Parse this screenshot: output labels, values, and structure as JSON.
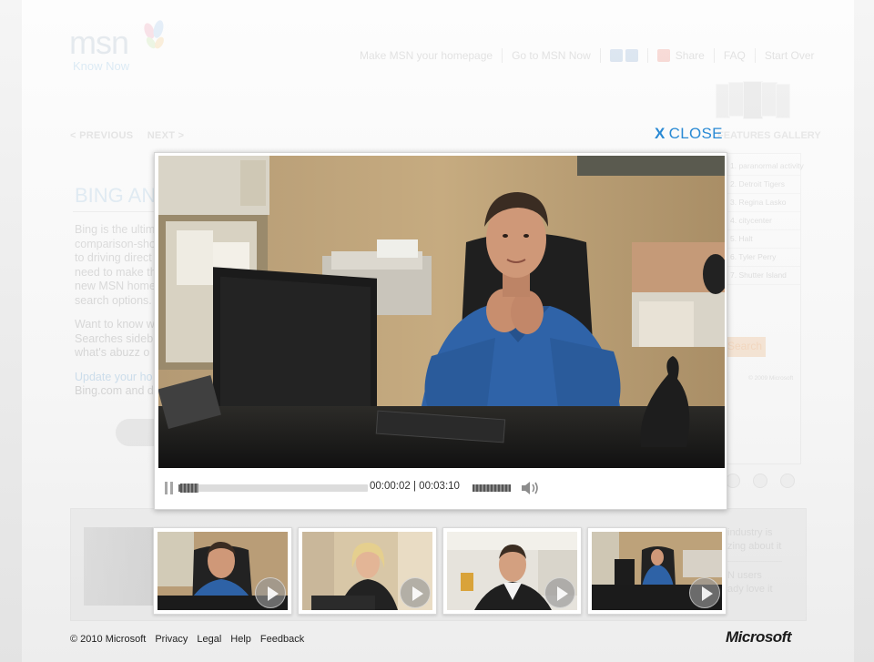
{
  "brand": {
    "name": "msn",
    "tagline": "Know Now"
  },
  "topnav": {
    "homepage": "Make MSN your homepage",
    "msn_now": "Go to MSN Now",
    "share": "Share",
    "faq": "FAQ",
    "start_over": "Start Over"
  },
  "pager": {
    "previous": "< PREVIOUS",
    "next": "NEXT >"
  },
  "gallery_label": "FEATURES GALLERY",
  "bing_section": {
    "title": "BING AN",
    "paragraph1": [
      "Bing is the ultim",
      "comparison-sho",
      "to driving direct",
      "need to make th",
      "new MSN home",
      "search options."
    ],
    "paragraph2": [
      "Want to know w",
      "Searches sideb",
      "what's abuzz o"
    ],
    "link": "Update your ho",
    "link_line2": "Bing.com and d"
  },
  "right_panel": {
    "items": [
      "1. paranormal activity",
      "2. Detroit Tigers",
      "3. Regina Lasko",
      "4. citycenter",
      "5. Halt",
      "6. Tyler Perry",
      "7. Shutter Island"
    ],
    "search_label": "Search",
    "copyright": "© 2009 Microsoft"
  },
  "strip_text": {
    "line1": "industry is",
    "line2": "zing about it",
    "line3": "N users",
    "line4": "ady love it"
  },
  "modal": {
    "close_label": "CLOSE",
    "close_x": "X"
  },
  "player": {
    "current_time": "00:00:02",
    "duration": "00:03:10",
    "separator": "|",
    "progress_fraction": 0.01,
    "volume_fraction": 1.0,
    "state": "playing"
  },
  "thumbnails": [
    {
      "name": "video-1"
    },
    {
      "name": "video-2"
    },
    {
      "name": "video-3"
    },
    {
      "name": "video-4"
    }
  ],
  "footer": {
    "copyright": "© 2010 Microsoft",
    "privacy": "Privacy",
    "legal": "Legal",
    "help": "Help",
    "feedback": "Feedback",
    "company_logo": "Microsoft"
  },
  "colors": {
    "close_blue": "#2a8ad4",
    "page_bg": "#e9e9e9"
  }
}
